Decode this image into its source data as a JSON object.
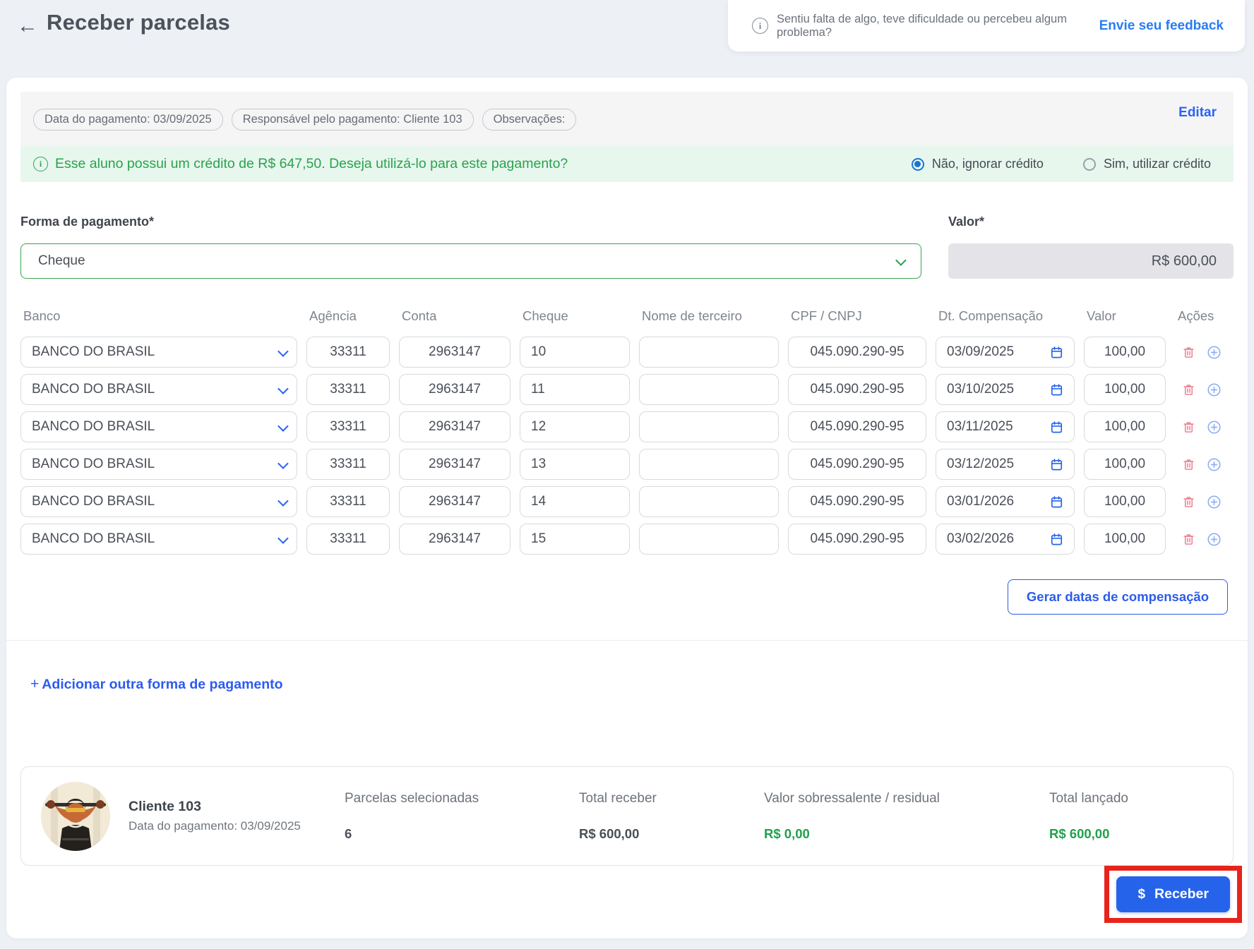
{
  "icons": {
    "back": "←",
    "info": "i",
    "plus": "+",
    "dollar": "$"
  },
  "header": {
    "title": "Receber parcelas"
  },
  "feedback": {
    "message": "Sentiu falta de algo, teve dificuldade ou percebeu algum problema?",
    "link": "Envie seu feedback"
  },
  "chips": [
    "Data do pagamento: 03/09/2025",
    "Responsável pelo pagamento: Cliente 103",
    "Observações:"
  ],
  "edit_link": "Editar",
  "credit_banner": {
    "message": "Esse aluno possui um crédito de R$ 647,50. Deseja utilizá-lo para este pagamento?",
    "options": [
      {
        "label": "Não, ignorar crédito",
        "state": "checked"
      },
      {
        "label": "Sim, utilizar crédito",
        "state": "unchecked"
      }
    ]
  },
  "payment_form": {
    "method_label": "Forma de pagamento*",
    "method_value": "Cheque",
    "amount_label": "Valor*",
    "amount_value": "R$ 600,00"
  },
  "table": {
    "headers": [
      "Banco",
      "Agência",
      "Conta",
      "Cheque",
      "Nome de terceiro",
      "CPF / CNPJ",
      "Dt. Compensação",
      "Valor",
      "Ações"
    ],
    "rows": [
      {
        "banco": "BANCO DO BRASIL",
        "agencia": "33311",
        "conta": "2963147",
        "cheque": "10",
        "nome_terceiro": "",
        "cpf_cnpj": "045.090.290-95",
        "dt_compensacao": "03/09/2025",
        "valor": "100,00"
      },
      {
        "banco": "BANCO DO BRASIL",
        "agencia": "33311",
        "conta": "2963147",
        "cheque": "11",
        "nome_terceiro": "",
        "cpf_cnpj": "045.090.290-95",
        "dt_compensacao": "03/10/2025",
        "valor": "100,00"
      },
      {
        "banco": "BANCO DO BRASIL",
        "agencia": "33311",
        "conta": "2963147",
        "cheque": "12",
        "nome_terceiro": "",
        "cpf_cnpj": "045.090.290-95",
        "dt_compensacao": "03/11/2025",
        "valor": "100,00"
      },
      {
        "banco": "BANCO DO BRASIL",
        "agencia": "33311",
        "conta": "2963147",
        "cheque": "13",
        "nome_terceiro": "",
        "cpf_cnpj": "045.090.290-95",
        "dt_compensacao": "03/12/2025",
        "valor": "100,00"
      },
      {
        "banco": "BANCO DO BRASIL",
        "agencia": "33311",
        "conta": "2963147",
        "cheque": "14",
        "nome_terceiro": "",
        "cpf_cnpj": "045.090.290-95",
        "dt_compensacao": "03/01/2026",
        "valor": "100,00"
      },
      {
        "banco": "BANCO DO BRASIL",
        "agencia": "33311",
        "conta": "2963147",
        "cheque": "15",
        "nome_terceiro": "",
        "cpf_cnpj": "045.090.290-95",
        "dt_compensacao": "03/02/2026",
        "valor": "100,00"
      }
    ]
  },
  "generate_dates_button": "Gerar datas de compensação",
  "add_payment_link": "Adicionar outra forma de pagamento",
  "summary": {
    "client_name": "Cliente 103",
    "client_subtitle": "Data do pagamento: 03/09/2025",
    "stats": [
      {
        "label": "Parcelas selecionadas",
        "value": "6",
        "color": "dark"
      },
      {
        "label": "Total receber",
        "value": "R$ 600,00",
        "color": "dark"
      },
      {
        "label": "Valor sobressalente / residual",
        "value": "R$ 0,00",
        "color": "green"
      },
      {
        "label": "Total lançado",
        "value": "R$ 600,00",
        "color": "green"
      }
    ]
  },
  "receive_button": {
    "label": "Receber"
  },
  "colors": {
    "accent_blue": "#2a63f5",
    "button_blue": "#2563eb",
    "success_green": "#2aa24c",
    "green_bg": "#e7f7ee",
    "select_border_green": "#38a44f",
    "input_border": "#d7dade",
    "trash_pink": "#ef8397",
    "plus_blue": "#8fb0f4",
    "annotation_red": "#e8231c",
    "page_bg": "#edf0f5"
  }
}
